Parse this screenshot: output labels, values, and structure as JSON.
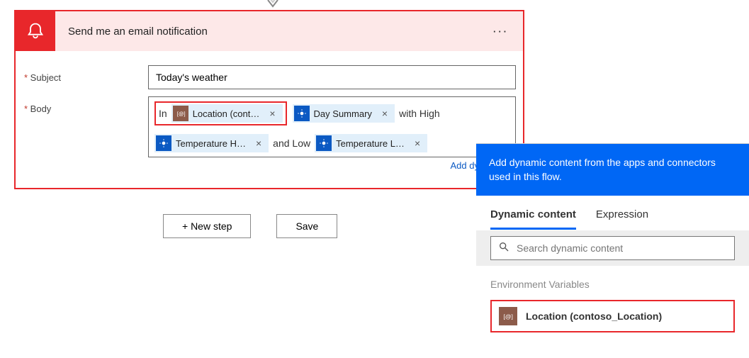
{
  "action": {
    "title": "Send me an email notification",
    "fields": {
      "subject_label": "Subject",
      "subject_value": "Today's weather",
      "body_label": "Body"
    },
    "body_text": {
      "t1": "In",
      "t2": "with High",
      "t3": "and Low"
    },
    "tokens": {
      "location": "Location (cont…",
      "day_summary": "Day Summary",
      "temp_high": "Temperature H…",
      "temp_low": "Temperature L…"
    },
    "add_dynamic": "Add dynamic co"
  },
  "buttons": {
    "new_step": "+ New step",
    "save": "Save"
  },
  "panel": {
    "hint": "Add dynamic content from the apps and connectors used in this flow.",
    "tabs": {
      "dynamic": "Dynamic content",
      "expression": "Expression"
    },
    "search_placeholder": "Search dynamic content",
    "groups": {
      "env_vars_title": "Environment Variables",
      "env_vars_item": "Location (contoso_Location)"
    }
  }
}
